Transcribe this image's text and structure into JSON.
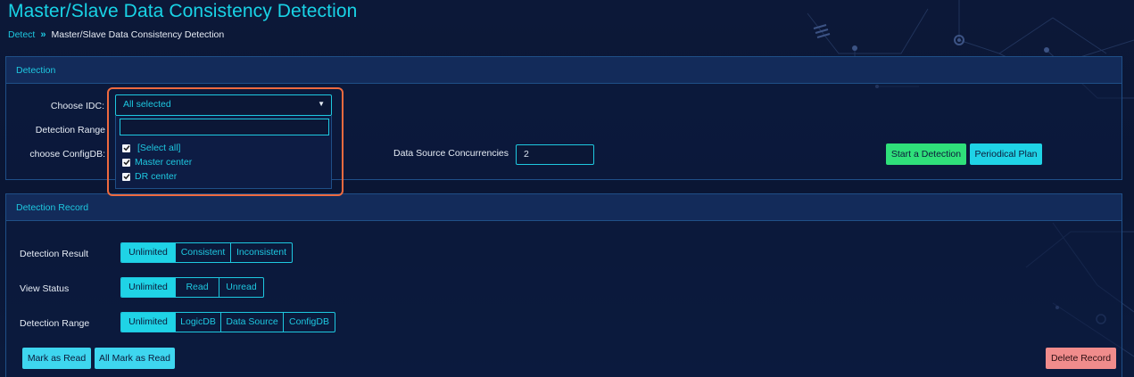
{
  "page": {
    "title": "Master/Slave Data Consistency Detection"
  },
  "breadcrumb": {
    "link": "Detect",
    "separator": "»",
    "current": "Master/Slave Data Consistency Detection"
  },
  "detection": {
    "header": "Detection",
    "choose_idc_label": "Choose IDC:",
    "detection_range_label": "Detection Range",
    "choose_configdb_label": "choose ConfigDB:",
    "idc_select": {
      "value": "All selected",
      "search_placeholder": "",
      "options": [
        {
          "label": "[Select all]",
          "checked": true
        },
        {
          "label": "Master center",
          "checked": true
        },
        {
          "label": "DR center",
          "checked": true
        }
      ]
    },
    "data_source_concurrencies_label": "Data Source Concurrencies",
    "data_source_concurrencies_value": "2",
    "start_button": "Start a Detection",
    "periodical_button": "Periodical Plan"
  },
  "record": {
    "header": "Detection Record",
    "detection_result": {
      "label": "Detection Result",
      "options": [
        "Unlimited",
        "Consistent",
        "Inconsistent"
      ],
      "selected": "Unlimited"
    },
    "view_status": {
      "label": "View Status",
      "options": [
        "Unlimited",
        "Read",
        "Unread"
      ],
      "selected": "Unlimited"
    },
    "detection_range": {
      "label": "Detection Range",
      "options": [
        "Unlimited",
        "LogicDB",
        "Data Source",
        "ConfigDB"
      ],
      "selected": "Unlimited"
    },
    "mark_read_button": "Mark as Read",
    "all_mark_read_button": "All Mark as Read",
    "delete_button": "Delete Record"
  },
  "colors": {
    "accent": "#1fd3e6",
    "start_button": "#2fe07a",
    "delete_button": "#f08c8c",
    "highlight": "#ee6a3f",
    "background": "#0b1a3c"
  },
  "icons": {
    "breadcrumb_separator": "double-chevron-right-icon",
    "select_caret": "caret-down-icon",
    "checkbox": "checkbox-checked-icon"
  }
}
